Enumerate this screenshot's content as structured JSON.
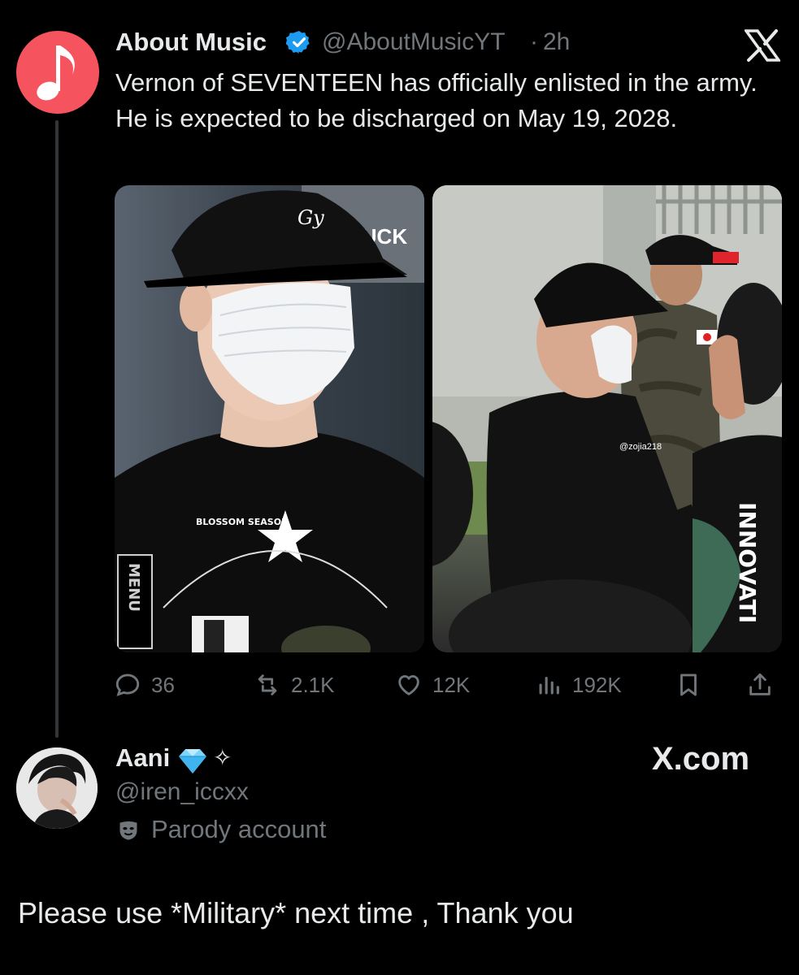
{
  "post": {
    "author_name": "About Music",
    "handle": "@AboutMusicYT",
    "separator": "·",
    "time": "2h",
    "text": "Vernon of SEVENTEEN has officially enlisted in the army. He is expected to be discharged on May 19, 2028.",
    "photo1_shirt_text": "BLOSSOM SEASON",
    "photo1_sign_text": "BUCK",
    "photo1_menu_text": "MENU",
    "photo2_watermark": "@zojia218",
    "photo2_shirt_text": "INNOVATI",
    "stats": {
      "replies": "36",
      "reposts": "2.1K",
      "likes": "12K",
      "views": "192K"
    }
  },
  "reply": {
    "author_name": "Aani",
    "handle": "@iren_iccxx",
    "badge": "Parody account",
    "sparkle": "✧",
    "source": "X.com",
    "text": "Please use *Military* next time , Thank you"
  },
  "colors": {
    "background": "#000000",
    "primary_text": "#e7e9ea",
    "secondary_text": "#71767b",
    "verified_blue": "#1d9bf0",
    "avatar_red": "#f5545f"
  }
}
